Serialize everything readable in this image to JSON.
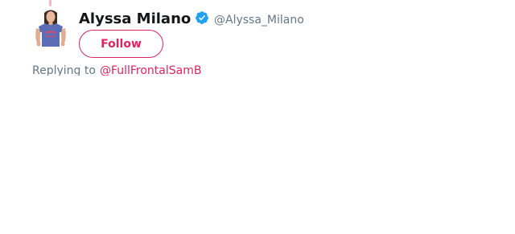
{
  "tweet": {
    "author": {
      "display_name": "Alyssa Milano",
      "handle": "@Alyssa_Milano",
      "verified": true,
      "avatar_icon": "profile-photo"
    },
    "follow_button_label": "Follow",
    "replying_to": {
      "prefix": "Replying to",
      "handle": "@FullFrontalSamB"
    }
  },
  "colors": {
    "accent": "#e0245e",
    "verified_blue": "#1da1f2",
    "name_text": "#14171a",
    "secondary_text": "#657786",
    "thread_line": "#f4b6cc"
  },
  "icons": {
    "verified": "verified-badge-icon"
  }
}
